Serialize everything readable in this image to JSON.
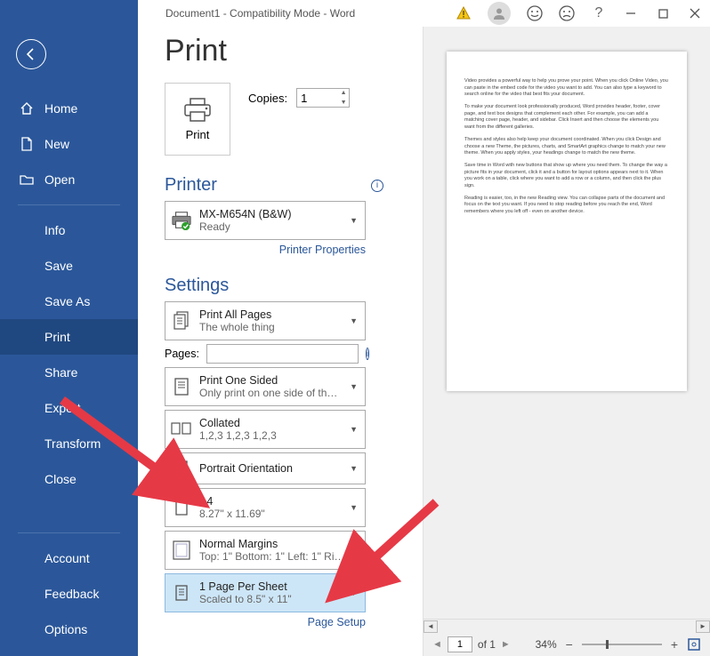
{
  "titlebar": {
    "title": "Document1  -  Compatibility Mode  -  Word"
  },
  "sidebar": {
    "home": "Home",
    "new": "New",
    "open": "Open",
    "info": "Info",
    "save": "Save",
    "saveas": "Save As",
    "print": "Print",
    "share": "Share",
    "export": "Export",
    "transform": "Transform",
    "close": "Close",
    "account": "Account",
    "feedback": "Feedback",
    "options": "Options"
  },
  "page": {
    "heading": "Print",
    "print_button": "Print",
    "copies_label": "Copies:",
    "copies_value": "1"
  },
  "printer": {
    "section": "Printer",
    "name": "MX-M654N (B&W)",
    "status": "Ready",
    "properties_link": "Printer Properties"
  },
  "settings": {
    "section": "Settings",
    "print_all": {
      "title": "Print All Pages",
      "sub": "The whole thing"
    },
    "pages_label": "Pages:",
    "pages_value": "",
    "one_sided": {
      "title": "Print One Sided",
      "sub": "Only print on one side of th…"
    },
    "collated": {
      "title": "Collated",
      "sub": "1,2,3    1,2,3    1,2,3"
    },
    "orientation": {
      "title": "Portrait Orientation"
    },
    "paper": {
      "title": "A4",
      "sub": "8.27\" x 11.69\""
    },
    "margins": {
      "title": "Normal Margins",
      "sub": "Top: 1\" Bottom: 1\" Left: 1\" Ri…"
    },
    "per_sheet": {
      "title": "1 Page Per Sheet",
      "sub": "Scaled to 8.5\" x 11\""
    },
    "page_setup_link": "Page Setup"
  },
  "preview": {
    "page_input": "1",
    "page_of": "of 1",
    "zoom": "34%",
    "paragraphs": [
      "Video provides a powerful way to help you prove your point. When you click Online Video, you can paste in the embed code for the video you want to add. You can also type a keyword to search online for the video that best fits your document.",
      "To make your document look professionally produced, Word provides header, footer, cover page, and text box designs that complement each other. For example, you can add a matching cover page, header, and sidebar. Click Insert and then choose the elements you want from the different galleries.",
      "Themes and styles also help keep your document coordinated. When you click Design and choose a new Theme, the pictures, charts, and SmartArt graphics change to match your new theme. When you apply styles, your headings change to match the new theme.",
      "Save time in Word with new buttons that show up where you need them. To change the way a picture fits in your document, click it and a button for layout options appears next to it. When you work on a table, click where you want to add a row or a column, and then click the plus sign.",
      "Reading is easier, too, in the new Reading view. You can collapse parts of the document and focus on the text you want. If you need to stop reading before you reach the end, Word remembers where you left off - even on another device."
    ]
  }
}
